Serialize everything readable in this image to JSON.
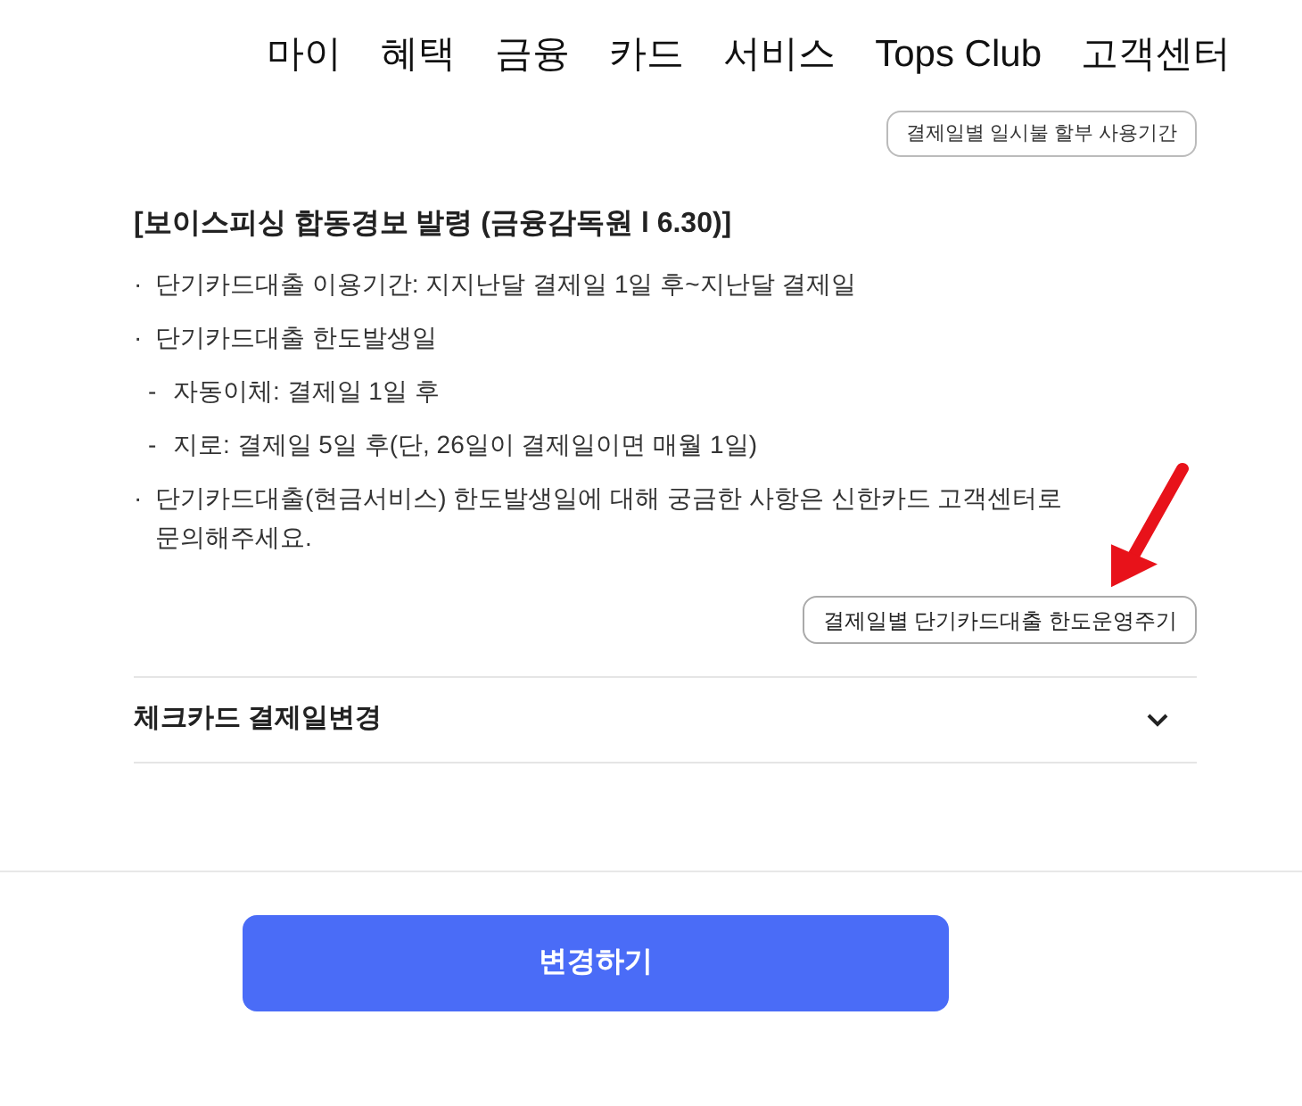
{
  "nav": {
    "items": [
      "마이",
      "혜택",
      "금융",
      "카드",
      "서비스",
      "Tops Club",
      "고객센터"
    ]
  },
  "top_button": {
    "label": "결제일별 일시불 할부 사용기간"
  },
  "notice": {
    "title": "[보이스피싱 합동경보 발령 (금융감독원 l 6.30)]",
    "items": [
      {
        "kind": "bullet",
        "marker": "·",
        "text": "단기카드대출 이용기간: 지지난달 결제일 1일 후~지난달 결제일"
      },
      {
        "kind": "bullet",
        "marker": "·",
        "text": "단기카드대출 한도발생일"
      },
      {
        "kind": "dash",
        "marker": "-",
        "text": "자동이체: 결제일 1일 후"
      },
      {
        "kind": "dash",
        "marker": "-",
        "text": "지로: 결제일 5일 후(단, 26일이 결제일이면 매월 1일)"
      },
      {
        "kind": "bullet",
        "marker": "·",
        "text": "단기카드대출(현금서비스) 한도발생일에 대해 궁금한 사항은 신한카드 고객센터로 문의해주세요."
      }
    ],
    "button": "결제일별 단기카드대출 한도운영주기"
  },
  "accordion": {
    "title": "체크카드 결제일변경",
    "expanded": false
  },
  "submit": {
    "label": "변경하기"
  }
}
